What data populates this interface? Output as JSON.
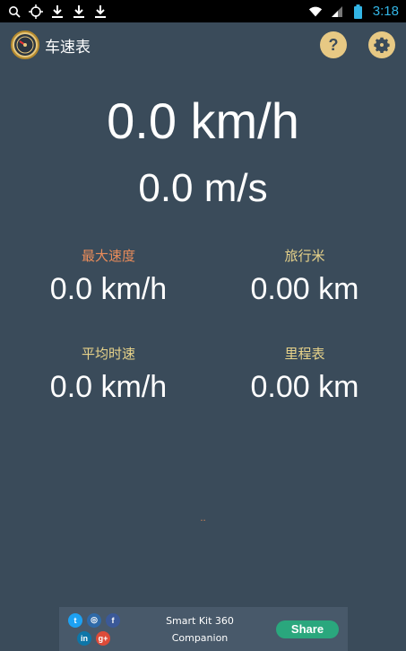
{
  "status_bar": {
    "time": "3:18",
    "icons": [
      "search-icon",
      "crosshair-icon",
      "download-icon",
      "download-icon",
      "download-icon",
      "wifi-icon",
      "signal-icon",
      "battery-icon"
    ]
  },
  "app_bar": {
    "title": "车速表",
    "help_label": "?",
    "icons": [
      "speedometer-icon",
      "help-icon",
      "gear-icon"
    ]
  },
  "speed": {
    "kmh": "0.0 km/h",
    "ms": "0.0 m/s"
  },
  "stats": {
    "max_speed": {
      "label": "最大速度",
      "value": "0.0 km/h",
      "color": "#e98c5a"
    },
    "trip": {
      "label": "旅行米",
      "value": "0.00 km",
      "color": "#e8d38a"
    },
    "avg_speed": {
      "label": "平均时速",
      "value": "0.0 km/h",
      "color": "#e8d38a"
    },
    "odometer": {
      "label": "里程表",
      "value": "0.00 km",
      "color": "#e8d38a"
    }
  },
  "indicator": "..",
  "ad": {
    "line1": "Smart Kit 360",
    "line2": "Companion",
    "share_label": "Share",
    "social": [
      {
        "name": "twitter-icon",
        "glyph": "t",
        "color": "#1da1f2"
      },
      {
        "name": "instagram-icon",
        "glyph": "◎",
        "color": "#2f6aa8"
      },
      {
        "name": "facebook-icon",
        "glyph": "f",
        "color": "#3b5998"
      },
      {
        "name": "linkedin-icon",
        "glyph": "in",
        "color": "#0e76a8"
      },
      {
        "name": "googleplus-icon",
        "glyph": "g+",
        "color": "#dd4b39"
      }
    ]
  }
}
